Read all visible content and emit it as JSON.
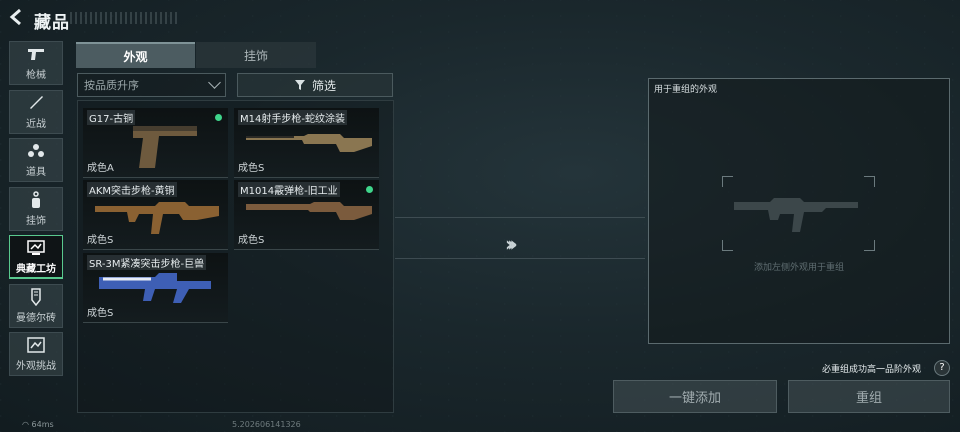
{
  "header": {
    "back_icon": "back-arrow-icon",
    "title": "藏品"
  },
  "nav": [
    {
      "label": "枪械",
      "icon": "pistol-icon"
    },
    {
      "label": "近战",
      "icon": "knife-icon"
    },
    {
      "label": "道具",
      "icon": "grenade-icon"
    },
    {
      "label": "挂饰",
      "icon": "charm-icon"
    },
    {
      "label": "典藏工坊",
      "icon": "workshop-icon",
      "active": true
    },
    {
      "label": "曼德尔砖",
      "icon": "brick-icon"
    },
    {
      "label": "外观挑战",
      "icon": "challenge-icon"
    }
  ],
  "tabs": [
    {
      "label": "外观",
      "active": true
    },
    {
      "label": "挂饰",
      "active": false
    }
  ],
  "sort": {
    "value": "按品质升序"
  },
  "filter": {
    "label": "筛选",
    "icon": "filter-icon"
  },
  "items": [
    {
      "name": "G17-古铜",
      "quality": "成色A",
      "new": true,
      "weapon": "pistol",
      "color": "#6e5a3e"
    },
    {
      "name": "M14射手步枪-蛇纹涂装",
      "quality": "成色S",
      "new": false,
      "weapon": "rifle",
      "color": "#8a7651"
    },
    {
      "name": "AKM突击步枪-黄铜",
      "quality": "成色S",
      "new": false,
      "weapon": "ak",
      "color": "#8a6132"
    },
    {
      "name": "M1014霰弹枪-旧工业",
      "quality": "成色S",
      "new": true,
      "weapon": "shotgun",
      "color": "#7b5b3d"
    },
    {
      "name": "SR-3M紧凑突击步枪-巨兽",
      "quality": "成色S",
      "new": false,
      "weapon": "smg",
      "color": "#3e5fb5"
    }
  ],
  "arrows": "›››",
  "regroup": {
    "title": "用于重组的外观",
    "hint": "添加左侧外观用于重组"
  },
  "note": "必重组成功高一品阶外观",
  "help_icon": "question-icon",
  "buttons": {
    "add_all": "一键添加",
    "regroup": "重组"
  },
  "status": {
    "ping": "64ms",
    "build": "5.202606141326"
  },
  "colors": {
    "accent": "#59c98e",
    "new_dot": "#3fd58b"
  }
}
